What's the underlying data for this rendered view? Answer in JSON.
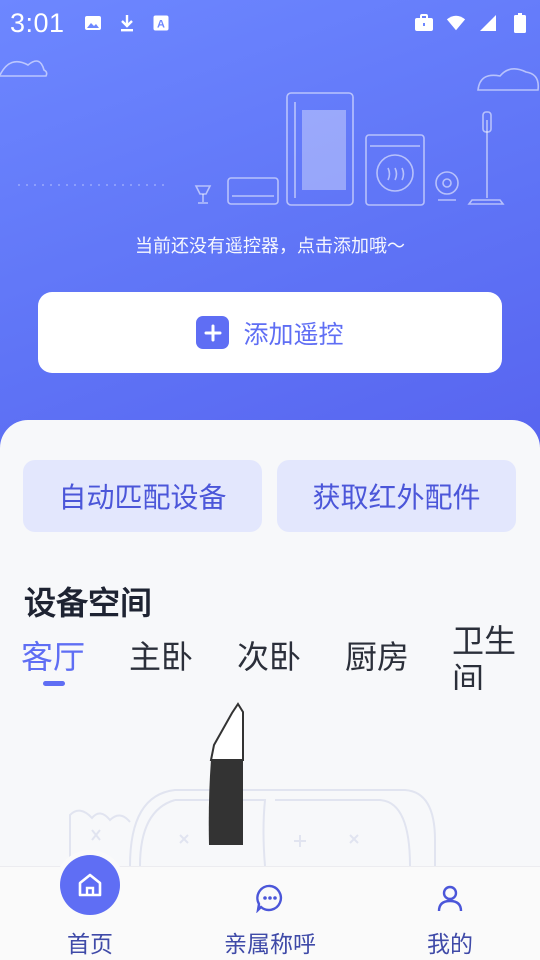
{
  "status_bar": {
    "time": "3:01",
    "left_icons": [
      "image-icon",
      "download-icon",
      "font-icon"
    ],
    "right_icons": [
      "briefcase-icon",
      "wifi-icon",
      "signal-icon",
      "battery-icon"
    ]
  },
  "hero": {
    "empty_message": "当前还没有遥控器，点击添加哦～",
    "add_button_label": "添加遥控"
  },
  "quick_actions": {
    "auto_match": "自动匹配设备",
    "get_ir": "获取红外配件"
  },
  "rooms": {
    "title": "设备空间",
    "tabs": [
      "客厅",
      "主卧",
      "次卧",
      "厨房",
      "卫生间"
    ],
    "active_index": 0
  },
  "bottom_nav": {
    "items": [
      {
        "label": "首页",
        "icon": "home-icon",
        "active": true
      },
      {
        "label": "亲属称呼",
        "icon": "chat-icon",
        "active": false
      },
      {
        "label": "我的",
        "icon": "user-icon",
        "active": false
      }
    ]
  },
  "colors": {
    "accent": "#5f6ef4",
    "hero_gradient_start": "#6d87ff",
    "hero_gradient_end": "#5763ef",
    "quick_bg": "#e3e7fd"
  }
}
